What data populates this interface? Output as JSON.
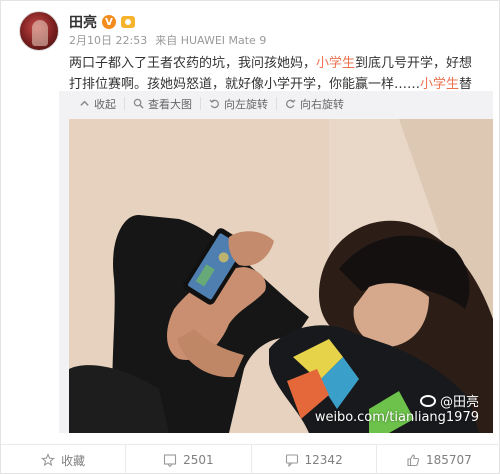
{
  "post": {
    "username": "田亮",
    "verified_badge": "V",
    "date": "2月10日 22:53",
    "source_prefix": "来自",
    "source_device": "HUAWEI Mate 9",
    "text_part1": "两口子都入了王者农药的坑，我问孩她妈，",
    "highlight1": "小学生",
    "text_part2": "到底几号开学，好想打排位赛啊。孩她妈怒道，就好像小学开学，你能赢一样……",
    "highlight2": "小学生",
    "text_part3": "替你背了多少锅",
    "emoji": "sweat-smile-emoji"
  },
  "toolbar": {
    "collapse": "收起",
    "view_large": "查看大图",
    "rotate_left": "向左旋转",
    "rotate_right": "向右旋转"
  },
  "watermark": {
    "handle": "@田亮",
    "url": "weibo.com/tianliang1979"
  },
  "actions": {
    "favorite": "收藏",
    "repost_count": "2501",
    "comment_count": "12342",
    "like_count": "185707"
  },
  "colors": {
    "highlight": "#eb7350",
    "verified": "#f28c1e",
    "meta": "#999999"
  }
}
